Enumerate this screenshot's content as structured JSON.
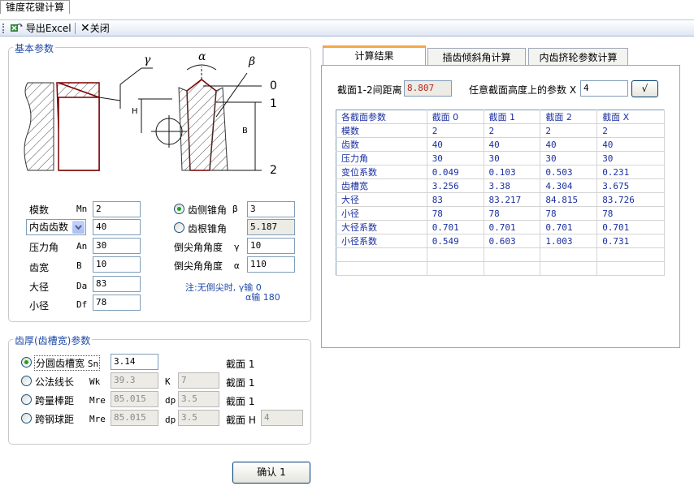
{
  "doc_tab": "锥度花键计算",
  "toolbar": {
    "export_label": "导出Excel",
    "close_label": "关闭"
  },
  "basic": {
    "title": "基本参数",
    "diagram": {
      "gamma": "γ",
      "alpha": "α",
      "beta": "β",
      "h_mark": "H",
      "b_mark": "B",
      "sec0": "0",
      "sec1": "1",
      "sec2": "2"
    },
    "rows": [
      {
        "label": "模数",
        "sym": "Mn",
        "value": "2"
      },
      {
        "label": "内齿齿数",
        "sym": "",
        "value": "40"
      },
      {
        "label": "压力角",
        "sym": "An",
        "value": "30"
      },
      {
        "label": "齿宽",
        "sym": "B",
        "value": "10"
      },
      {
        "label": "大径",
        "sym": "Da",
        "value": "83"
      },
      {
        "label": "小径",
        "sym": "Df",
        "value": "78"
      }
    ],
    "right_rows": [
      {
        "label": "齿侧锥角",
        "sym": "β",
        "value": "3"
      },
      {
        "label": "齿根锥角",
        "sym": "",
        "value": "5.187"
      },
      {
        "label": "倒尖角角度",
        "sym": "γ",
        "value": "10"
      },
      {
        "label": "倒尖角角度",
        "sym": "α",
        "value": "110"
      }
    ],
    "note_line1": "注:无倒尖时, γ输  0",
    "note_line2": "α输 180"
  },
  "thickness": {
    "title": "齿厚(齿槽宽)参数",
    "rows": [
      {
        "label": "分圆齿槽宽",
        "sym": "Sn",
        "value": "3.14",
        "k_label": "",
        "k_value": "",
        "sec_label": "截面 1"
      },
      {
        "label": "公法线长",
        "sym": "Wk",
        "value": "39.3",
        "k_label": "K",
        "k_value": "7",
        "sec_label": "截面 1"
      },
      {
        "label": "跨量棒距",
        "sym": "Mre",
        "value": "85.015",
        "k_label": "dp",
        "k_value": "3.5",
        "sec_label": "截面 1"
      },
      {
        "label": "跨钢球距",
        "sym": "Mre",
        "value": "85.015",
        "k_label": "dp",
        "k_value": "3.5",
        "sec_label": "截面 H",
        "h_value": "4"
      }
    ]
  },
  "confirm_label": "确认 1",
  "tabs": [
    "计算结果",
    "插齿倾斜角计算",
    "内齿挤轮参数计算"
  ],
  "results": {
    "dist_label": "截面1-2间距离",
    "dist_value": "8.807",
    "any_label": "任意截面高度上的参数  X",
    "any_value": "4",
    "calc_label": "√",
    "headers": [
      "各截面参数",
      "截面 0",
      "截面 1",
      "截面 2",
      "截面 X"
    ],
    "rows": [
      [
        "模数",
        "2",
        "2",
        "2",
        "2"
      ],
      [
        "齿数",
        "40",
        "40",
        "40",
        "40"
      ],
      [
        "压力角",
        "30",
        "30",
        "30",
        "30"
      ],
      [
        "变位系数",
        "0.049",
        "0.103",
        "0.503",
        "0.231"
      ],
      [
        "齿槽宽",
        "3.256",
        "3.38",
        "4.304",
        "3.675"
      ],
      [
        "大径",
        "83",
        "83.217",
        "84.815",
        "83.726"
      ],
      [
        "小径",
        "78",
        "78",
        "78",
        "78"
      ],
      [
        "大径系数",
        "0.701",
        "0.701",
        "0.701",
        "0.701"
      ],
      [
        "小径系数",
        "0.549",
        "0.603",
        "1.003",
        "0.731"
      ],
      [
        "",
        "",
        "",
        "",
        ""
      ],
      [
        "",
        "",
        "",
        "",
        ""
      ]
    ]
  }
}
